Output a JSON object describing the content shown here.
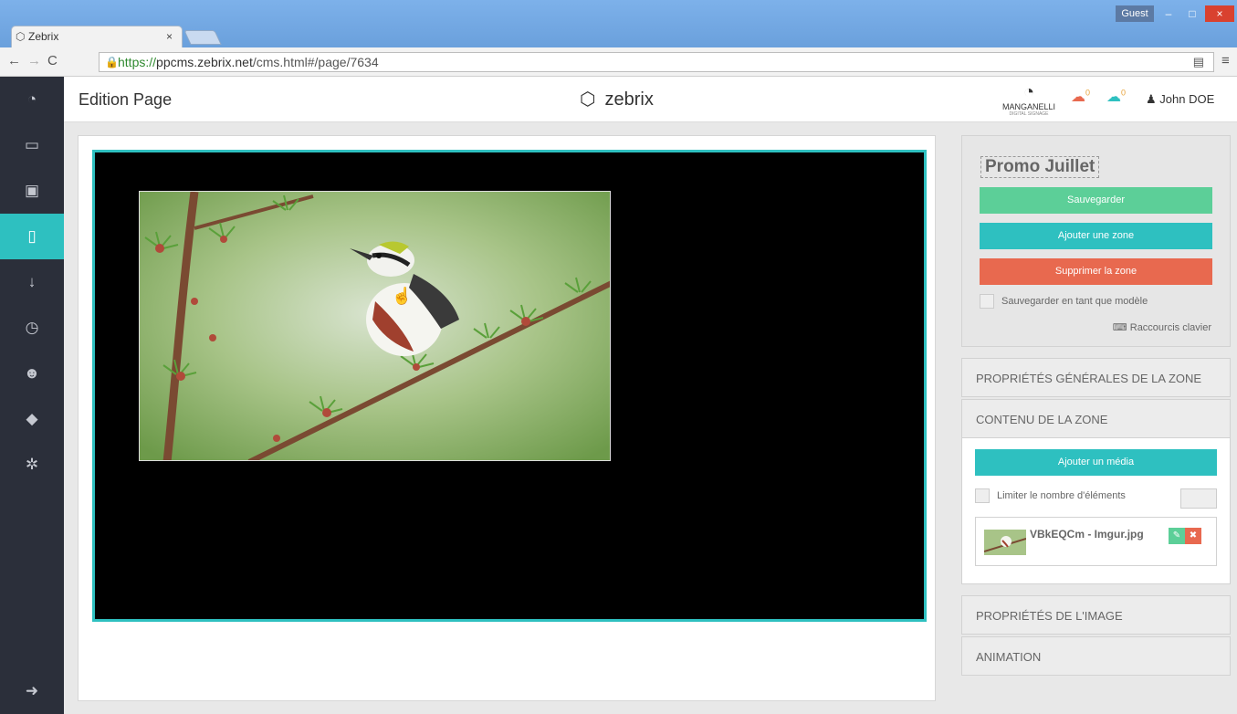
{
  "browser": {
    "tab_title": "Zebrix",
    "tab_close": "×",
    "guest_label": "Guest",
    "url_https": "https://",
    "url_host": "ppcms.zebrix.net",
    "url_path": "/cms.html#/page/7634",
    "minimize": "–",
    "maximize": "□",
    "close": "×"
  },
  "header": {
    "page_title": "Edition Page",
    "brand": "zebrix",
    "partner": "MANGANELLI",
    "partner_tagline": "DIGITAL SIGNAGE",
    "cloud_upload_count": "0",
    "cloud_download_count": "0",
    "user_name": "John DOE"
  },
  "sidebar": {
    "items": [
      {
        "icon": "dashboard-icon"
      },
      {
        "icon": "monitor-icon"
      },
      {
        "icon": "image-icon"
      },
      {
        "icon": "page-icon",
        "active": true
      },
      {
        "icon": "sort-numeric-icon"
      },
      {
        "icon": "clock-icon"
      },
      {
        "icon": "users-icon"
      },
      {
        "icon": "tags-icon"
      },
      {
        "icon": "gear-icon"
      },
      {
        "icon": "logout-icon"
      }
    ]
  },
  "editor": {
    "page_name": "Promo Juillet",
    "save_label": "Sauvegarder",
    "add_zone_label": "Ajouter une zone",
    "delete_zone_label": "Supprimer la zone",
    "save_as_template_label": "Sauvegarder en tant que modèle",
    "shortcuts_label": "Raccourcis clavier"
  },
  "accordion": {
    "general_props": "PROPRIÉTÉS GÉNÉRALES DE LA ZONE",
    "zone_content": "CONTENU DE LA ZONE",
    "image_props": "PROPRIÉTÉS DE L'IMAGE",
    "animation": "ANIMATION"
  },
  "zone_content": {
    "add_media_label": "Ajouter un média",
    "limit_label": "Limiter le nombre d'éléments",
    "media_items": [
      {
        "name": "VBkEQCm - Imgur.jpg"
      }
    ]
  },
  "colors": {
    "accent": "#2ec0c0",
    "save": "#5ccf98",
    "danger": "#e8694f",
    "sidebar": "#2b2f3a"
  }
}
